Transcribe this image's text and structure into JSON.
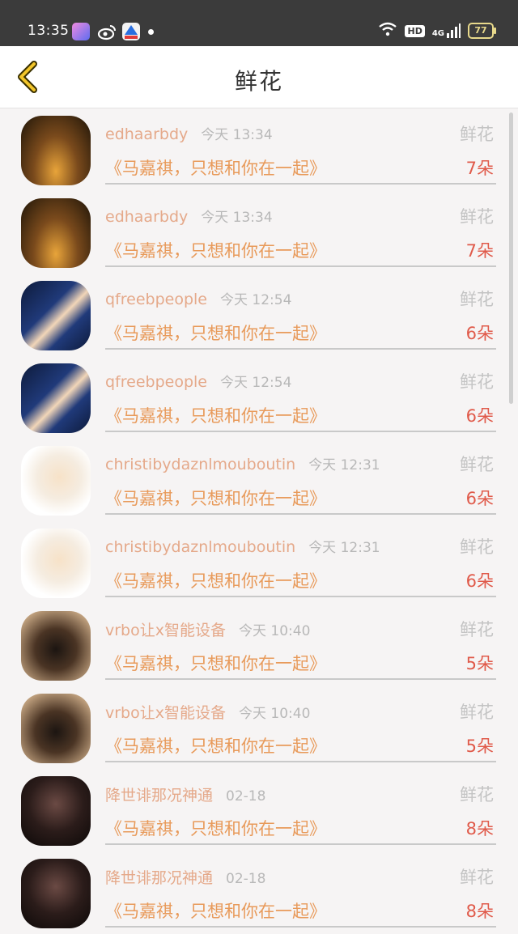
{
  "status_bar": {
    "time": "13:35",
    "right_hd": "HD",
    "right_net": "4G",
    "battery": "77"
  },
  "header": {
    "title": "鲜花",
    "back_icon": "chevron-left-icon"
  },
  "list": {
    "items": [
      {
        "avatar": "a",
        "user": "edhaarbdy",
        "time": "今天 13:34",
        "type": "鲜花",
        "book": "《马嘉祺，只想和你在一起》",
        "count": "7朵"
      },
      {
        "avatar": "a",
        "user": "edhaarbdy",
        "time": "今天 13:34",
        "type": "鲜花",
        "book": "《马嘉祺，只想和你在一起》",
        "count": "7朵"
      },
      {
        "avatar": "b",
        "user": "qfreebpeople",
        "time": "今天 12:54",
        "type": "鲜花",
        "book": "《马嘉祺，只想和你在一起》",
        "count": "6朵"
      },
      {
        "avatar": "b",
        "user": "qfreebpeople",
        "time": "今天 12:54",
        "type": "鲜花",
        "book": "《马嘉祺，只想和你在一起》",
        "count": "6朵"
      },
      {
        "avatar": "c",
        "user": "christibydaznlmouboutin",
        "time": "今天 12:31",
        "type": "鲜花",
        "book": "《马嘉祺，只想和你在一起》",
        "count": "6朵"
      },
      {
        "avatar": "c",
        "user": "christibydaznlmouboutin",
        "time": "今天 12:31",
        "type": "鲜花",
        "book": "《马嘉祺，只想和你在一起》",
        "count": "6朵"
      },
      {
        "avatar": "d",
        "user": "vrbo让x智能设备",
        "time": "今天 10:40",
        "type": "鲜花",
        "book": "《马嘉祺，只想和你在一起》",
        "count": "5朵"
      },
      {
        "avatar": "d",
        "user": "vrbo让x智能设备",
        "time": "今天 10:40",
        "type": "鲜花",
        "book": "《马嘉祺，只想和你在一起》",
        "count": "5朵"
      },
      {
        "avatar": "e",
        "user": "降世诽那况神通",
        "time": "02-18",
        "type": "鲜花",
        "book": "《马嘉祺，只想和你在一起》",
        "count": "8朵"
      },
      {
        "avatar": "e",
        "user": "降世诽那况神通",
        "time": "02-18",
        "type": "鲜花",
        "book": "《马嘉祺，只想和你在一起》",
        "count": "8朵"
      }
    ]
  }
}
